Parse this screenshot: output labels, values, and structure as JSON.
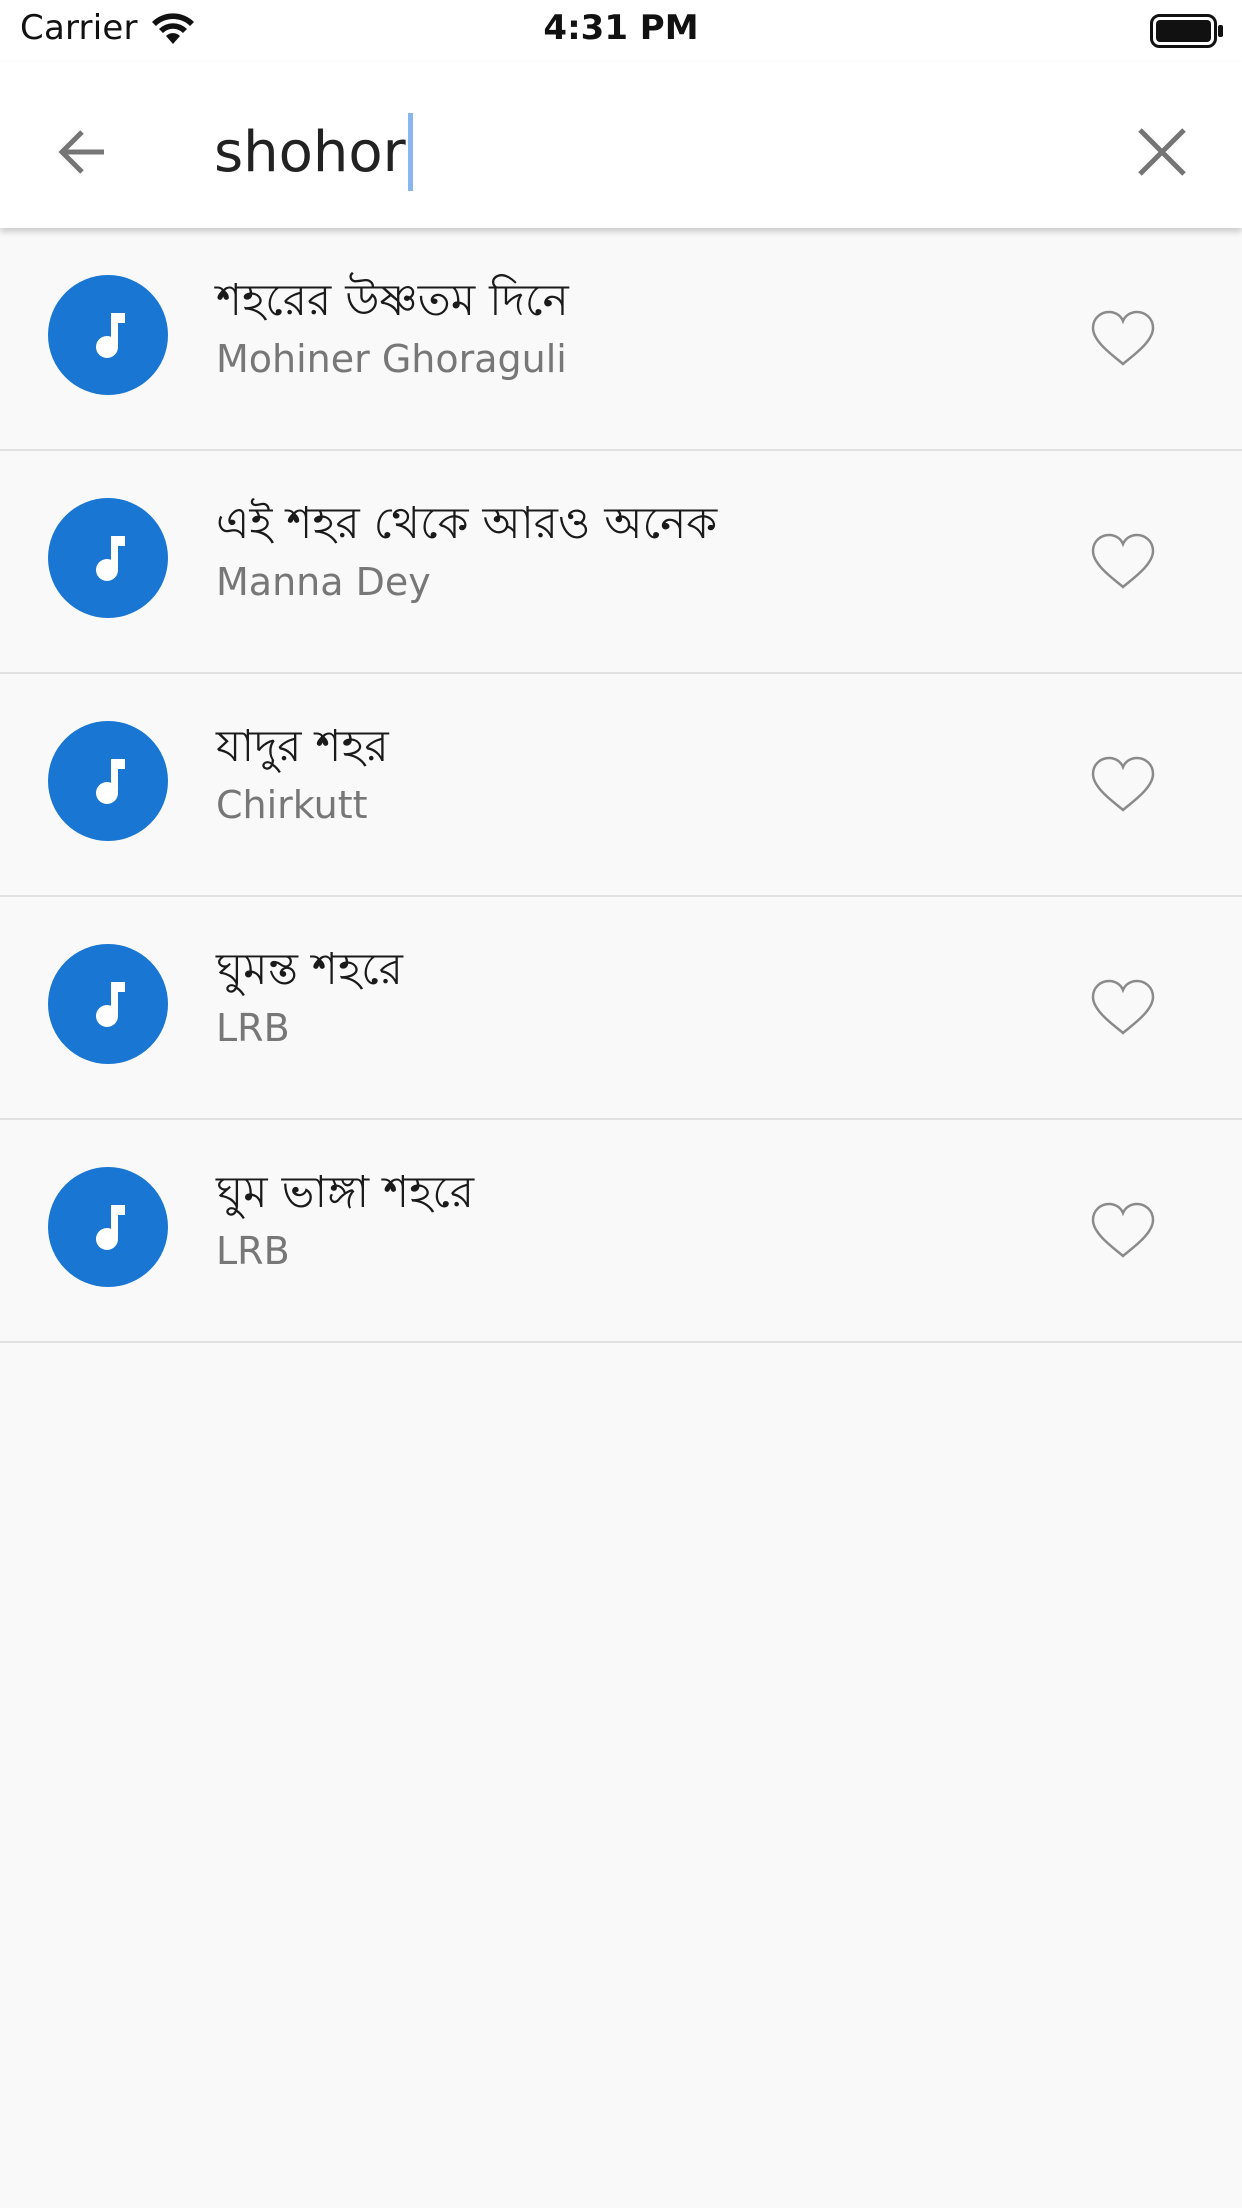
{
  "status_bar": {
    "carrier": "Carrier",
    "time": "4:31 PM"
  },
  "search": {
    "query": "shohor",
    "back_icon": "arrow-left-icon",
    "clear_icon": "close-icon"
  },
  "colors": {
    "accent": "#1976d2",
    "subtitle": "#777777",
    "divider": "#e2e2e2",
    "background": "#f9f9f9"
  },
  "results": [
    {
      "title": "শহরের উষ্ণতম দিনে",
      "artist": "Mohiner Ghoraguli",
      "favorite": false
    },
    {
      "title": "এই শহর থেকে আরও অনেক",
      "artist": "Manna Dey",
      "favorite": false
    },
    {
      "title": "যাদুর শহর",
      "artist": "Chirkutt",
      "favorite": false
    },
    {
      "title": "ঘুমন্ত শহরে",
      "artist": "LRB",
      "favorite": false
    },
    {
      "title": "ঘুম ভাঙ্গা শহরে",
      "artist": "LRB",
      "favorite": false
    }
  ]
}
